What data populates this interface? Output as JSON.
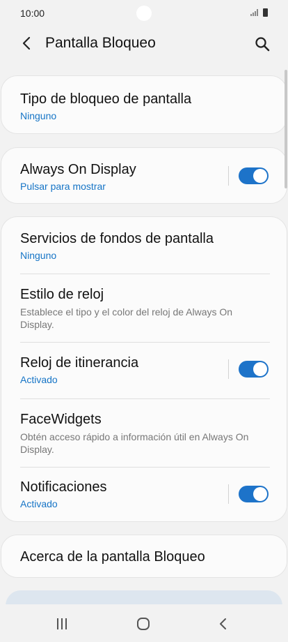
{
  "status_bar": {
    "time": "10:00"
  },
  "header": {
    "title": "Pantalla Bloqueo"
  },
  "cards": {
    "lock_type": {
      "title": "Tipo de bloqueo de pantalla",
      "value": "Ninguno"
    },
    "always_on": {
      "title": "Always On Display",
      "value": "Pulsar para mostrar",
      "enabled": true
    },
    "wallpaper_services": {
      "title": "Servicios de fondos de pantalla",
      "value": "Ninguno"
    },
    "clock_style": {
      "title": "Estilo de reloj",
      "description": "Establece el tipo y el color del reloj de Always On Display."
    },
    "roaming_clock": {
      "title": "Reloj de itinerancia",
      "value": "Activado",
      "enabled": true
    },
    "facewidgets": {
      "title": "FaceWidgets",
      "description": "Obtén acceso rápido a información útil en Always On Display."
    },
    "notifications": {
      "title": "Notificaciones",
      "value": "Activado",
      "enabled": true
    },
    "about": {
      "title": "Acerca de la pantalla Bloqueo"
    }
  },
  "colors": {
    "accent": "#1d73c9",
    "link": "#1574c6",
    "background": "#f2f2f2",
    "card": "#fbfbfb"
  },
  "icons": {
    "back": "back-arrow-icon",
    "search": "search-icon",
    "recents": "recents-icon",
    "home": "home-icon",
    "nav_back": "nav-back-icon"
  }
}
